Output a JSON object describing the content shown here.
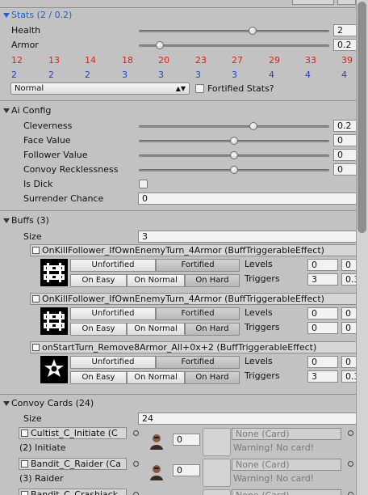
{
  "stats": {
    "header": "Stats (2 / 0.2)",
    "health_label": "Health",
    "health_value": "2",
    "armor_label": "Armor",
    "armor_value": "0.2",
    "red_values": [
      "12",
      "13",
      "14",
      "18",
      "20",
      "23",
      "27",
      "29",
      "33",
      "39"
    ],
    "blue_values": [
      "2",
      "2",
      "2",
      "3",
      "3",
      "3",
      "3",
      "4",
      "4",
      "4"
    ],
    "difficulty": "Normal",
    "fortified_label": "Fortified Stats?"
  },
  "ai": {
    "header": "Ai Config",
    "rows": [
      {
        "label": "Cleverness",
        "value": "0.2",
        "fraction": 0.6
      },
      {
        "label": "Face Value",
        "value": "0",
        "fraction": 0.5
      },
      {
        "label": "Follower Value",
        "value": "0",
        "fraction": 0.5
      },
      {
        "label": "Convoy Recklessness",
        "value": "0",
        "fraction": 0.5
      }
    ],
    "is_dick_label": "Is Dick",
    "surrender_label": "Surrender Chance",
    "surrender_value": "0"
  },
  "buffs": {
    "header": "Buffs (3)",
    "size_label": "Size",
    "size_value": "3",
    "items": [
      {
        "name": "OnKillFollower_IfOwnEnemyTurn_4Armor (BuffTriggerableEffect)",
        "icon": "barricade-icon",
        "levels": [
          "0",
          "0"
        ],
        "triggers": [
          "3",
          "0.3"
        ]
      },
      {
        "name": "OnKillFollower_IfOwnEnemyTurn_4Armor (BuffTriggerableEffect)",
        "icon": "barricade-icon",
        "levels": [
          "0",
          "0"
        ],
        "triggers": [
          "0",
          "0"
        ]
      },
      {
        "name": "onStartTurn_Remove8Armor_All+0x+2 (BuffTriggerableEffect)",
        "icon": "star-badge-icon",
        "levels": [
          "0",
          "0"
        ],
        "triggers": [
          "3",
          "0.3"
        ]
      }
    ],
    "btn_unfortified": "Unfortified",
    "btn_fortified": "Fortified",
    "btn_easy": "On Easy",
    "btn_normal": "On Normal",
    "btn_hard": "On Hard",
    "levels_label": "Levels",
    "triggers_label": "Triggers"
  },
  "convoy": {
    "header": "Convoy Cards (24)",
    "size_label": "Size",
    "size_value": "24",
    "cards": [
      {
        "asset": "Cultist_C_Initiate (C",
        "subtitle": "(2) Initiate",
        "count": "0",
        "none_card": "None (Card)",
        "warning": "Warning! No card!"
      },
      {
        "asset": "Bandit_C_Raider (Ca",
        "subtitle": "(3) Raider",
        "count": "0",
        "none_card": "None (Card)",
        "warning": "Warning! No card!"
      },
      {
        "asset": "Bandit_C_Crashjack",
        "subtitle": "",
        "count": "",
        "none_card": "None (Card)",
        "warning": ""
      }
    ]
  },
  "colors": {
    "accent_blue": "#1f61c4",
    "red_values": "#e0201c",
    "blue_values": "#1f3fd4",
    "panel_bg": "#c2c2c2"
  }
}
